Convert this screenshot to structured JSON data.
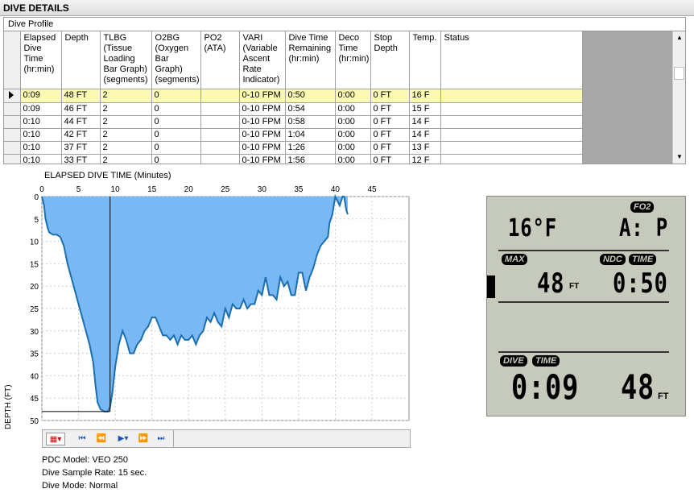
{
  "header": {
    "title": "DIVE DETAILS",
    "profile_label": "Dive Profile"
  },
  "table": {
    "columns": [
      "Elapsed Dive Time (hr:min)",
      "Depth",
      "TLBG (Tissue Loading Bar Graph) (segments)",
      "O2BG (Oxygen Bar Graph) (segments)",
      "PO2 (ATA)",
      "VARI (Variable Ascent Rate Indicator)",
      "Dive Time Remaining (hr:min)",
      "Deco Time (hr:min)",
      "Stop Depth",
      "Temp.",
      "Status"
    ],
    "rows": [
      [
        "0:09",
        "48 FT",
        "2",
        "0",
        "",
        "0-10 FPM",
        "0:50",
        "0:00",
        "0 FT",
        "16 F",
        ""
      ],
      [
        "0:09",
        "46 FT",
        "2",
        "0",
        "",
        "0-10 FPM",
        "0:54",
        "0:00",
        "0 FT",
        "15 F",
        ""
      ],
      [
        "0:10",
        "44 FT",
        "2",
        "0",
        "",
        "0-10 FPM",
        "0:58",
        "0:00",
        "0 FT",
        "14 F",
        ""
      ],
      [
        "0:10",
        "42 FT",
        "2",
        "0",
        "",
        "0-10 FPM",
        "1:04",
        "0:00",
        "0 FT",
        "14 F",
        ""
      ],
      [
        "0:10",
        "37 FT",
        "2",
        "0",
        "",
        "0-10 FPM",
        "1:26",
        "0:00",
        "0 FT",
        "13 F",
        ""
      ],
      [
        "0:10",
        "33 FT",
        "2",
        "0",
        "",
        "0-10 FPM",
        "1:56",
        "0:00",
        "0 FT",
        "12 F",
        ""
      ]
    ]
  },
  "chart_data": {
    "type": "area",
    "title": "ELAPSED DIVE TIME (Minutes)",
    "xlabel": "ELAPSED DIVE TIME (Minutes)",
    "ylabel": "DEPTH (FT)",
    "xlim": [
      0,
      45
    ],
    "ylim": [
      0,
      50
    ],
    "x_ticks": [
      "0",
      "5",
      "10",
      "15",
      "20",
      "25",
      "30",
      "35",
      "40",
      "45"
    ],
    "y_ticks": [
      "0",
      "5",
      "10",
      "15",
      "20",
      "25",
      "30",
      "35",
      "40",
      "45",
      "50"
    ],
    "cursor_x": 9.3,
    "cursor_depth": 48,
    "fill_color": "#78b8f5",
    "line_color": "#1b6fb0",
    "x": [
      0,
      0.3,
      0.5,
      0.8,
      1,
      1.5,
      2,
      2.5,
      3,
      3.5,
      4,
      4.5,
      5,
      5.5,
      6,
      6.5,
      7,
      7.3,
      7.6,
      8,
      8.5,
      9,
      9.3,
      9.6,
      10,
      10.5,
      11,
      11.5,
      12,
      12.5,
      13,
      13.5,
      14,
      14.5,
      15,
      15.5,
      16,
      16.5,
      17,
      17.5,
      18,
      18.5,
      19,
      19.5,
      20,
      20.5,
      21,
      21.5,
      22,
      22.5,
      23,
      23.5,
      24,
      24.5,
      25,
      25.5,
      26,
      26.5,
      27,
      27.5,
      28,
      28.5,
      29,
      29.5,
      30,
      30.5,
      31,
      31.5,
      32,
      32.5,
      33,
      33.5,
      34,
      34.5,
      35,
      35.5,
      36,
      36.5,
      37,
      37.5,
      38,
      38.5,
      39,
      39.2,
      39.6,
      40,
      40.3,
      40.6,
      41,
      41.2,
      41.5,
      41.7
    ],
    "y": [
      0,
      2,
      5,
      7,
      8,
      8.5,
      8.5,
      9,
      11,
      15,
      18,
      21,
      24,
      27,
      30,
      33,
      37,
      42,
      46,
      47.5,
      48,
      48,
      47,
      44,
      38,
      33,
      30,
      32,
      35,
      35,
      33,
      32,
      30,
      29,
      27,
      27,
      29,
      31,
      31,
      32,
      31,
      33,
      31,
      32,
      32,
      31,
      33,
      31,
      30,
      27,
      28,
      26,
      28,
      29,
      25,
      27,
      24,
      25,
      25,
      23,
      25,
      24,
      24,
      21,
      22,
      18,
      22,
      22,
      23,
      18,
      20,
      19,
      22,
      22,
      17,
      17,
      21,
      18,
      16,
      13,
      11,
      10,
      9,
      6,
      4,
      0,
      1,
      2,
      0,
      0,
      3,
      4
    ]
  },
  "toolbar": {
    "buttons": [
      "first",
      "prev",
      "play",
      "next",
      "last"
    ]
  },
  "info": {
    "model": "PDC Model: VEO 250",
    "rate": "Dive Sample Rate: 15 sec.",
    "mode": "Dive Mode: Normal"
  },
  "lcd": {
    "fo2_label": "FO2",
    "temp": "16°F",
    "fo2_value": "A: P",
    "max_label": "MAX",
    "ndc_label": "NDC",
    "time_label": "TIME",
    "max_depth": "48",
    "ft_unit": "FT",
    "ndc_time": "0:50",
    "dive_label": "DIVE",
    "dive_time_label": "TIME",
    "dive_time": "0:09",
    "dive_depth": "48",
    "dive_ft_unit": "FT"
  }
}
